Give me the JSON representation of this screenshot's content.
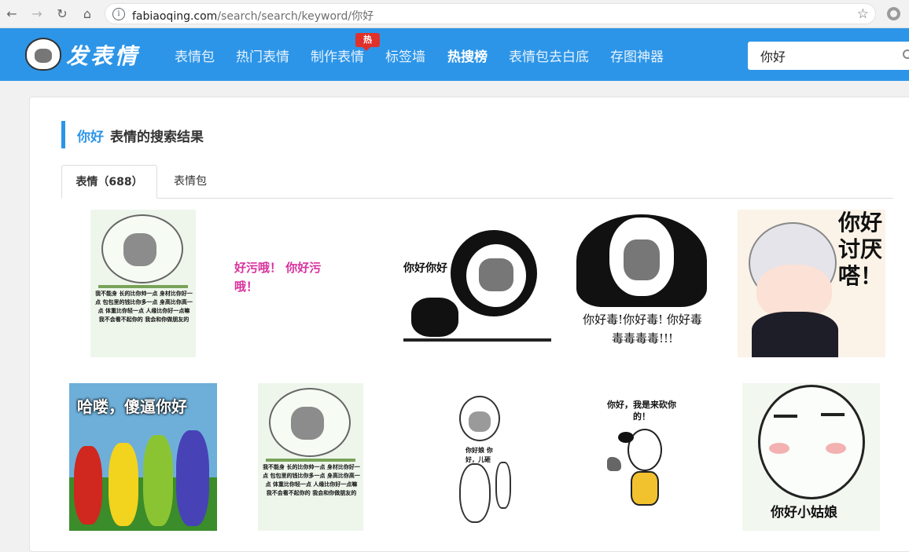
{
  "browser": {
    "url_host": "fabiaoqing.com",
    "url_path": "/search/search/keyword/你好"
  },
  "site": {
    "logo_text": "发表情",
    "menu": [
      "表情包",
      "热门表情",
      "制作表情",
      "标签墙",
      "热搜榜",
      "表情包去白底",
      "存图神器"
    ],
    "hot_badge": "热",
    "search_value": "你好"
  },
  "results": {
    "keyword": "你好",
    "heading": "表情的搜索结果",
    "tabs": [
      "表情（688）",
      "表情包"
    ]
  },
  "emojis": [
    {
      "caption": "我不能身 长的比你帅一点 身材比你好一点 包包里的钱比你多一点 身高比你高一点 体重比你轻一点 人缘比你好一点嘛 我不会看不起你的 我会和你做朋友的"
    },
    {
      "caption": "好污哦！ 你好污哦！"
    },
    {
      "caption": "你好你好"
    },
    {
      "caption": "你好毒!你好毒! 你好毒毒毒毒毒!!!"
    },
    {
      "caption": "你好讨厌嗒！"
    },
    {
      "caption": "哈喽，傻逼你好"
    },
    {
      "caption": "我不能身 长的比你帅一点 身材比你好一点 包包里的钱比你多一点 身高比你高一点 体重比你轻一点 人缘比你好一点嘛 我不会看不起你的 我会和你做朋友的"
    },
    {
      "caption": "你好娘 你好，儿砸"
    },
    {
      "caption": "你好，我是来砍你的！"
    },
    {
      "caption": "你好小姑娘"
    }
  ]
}
